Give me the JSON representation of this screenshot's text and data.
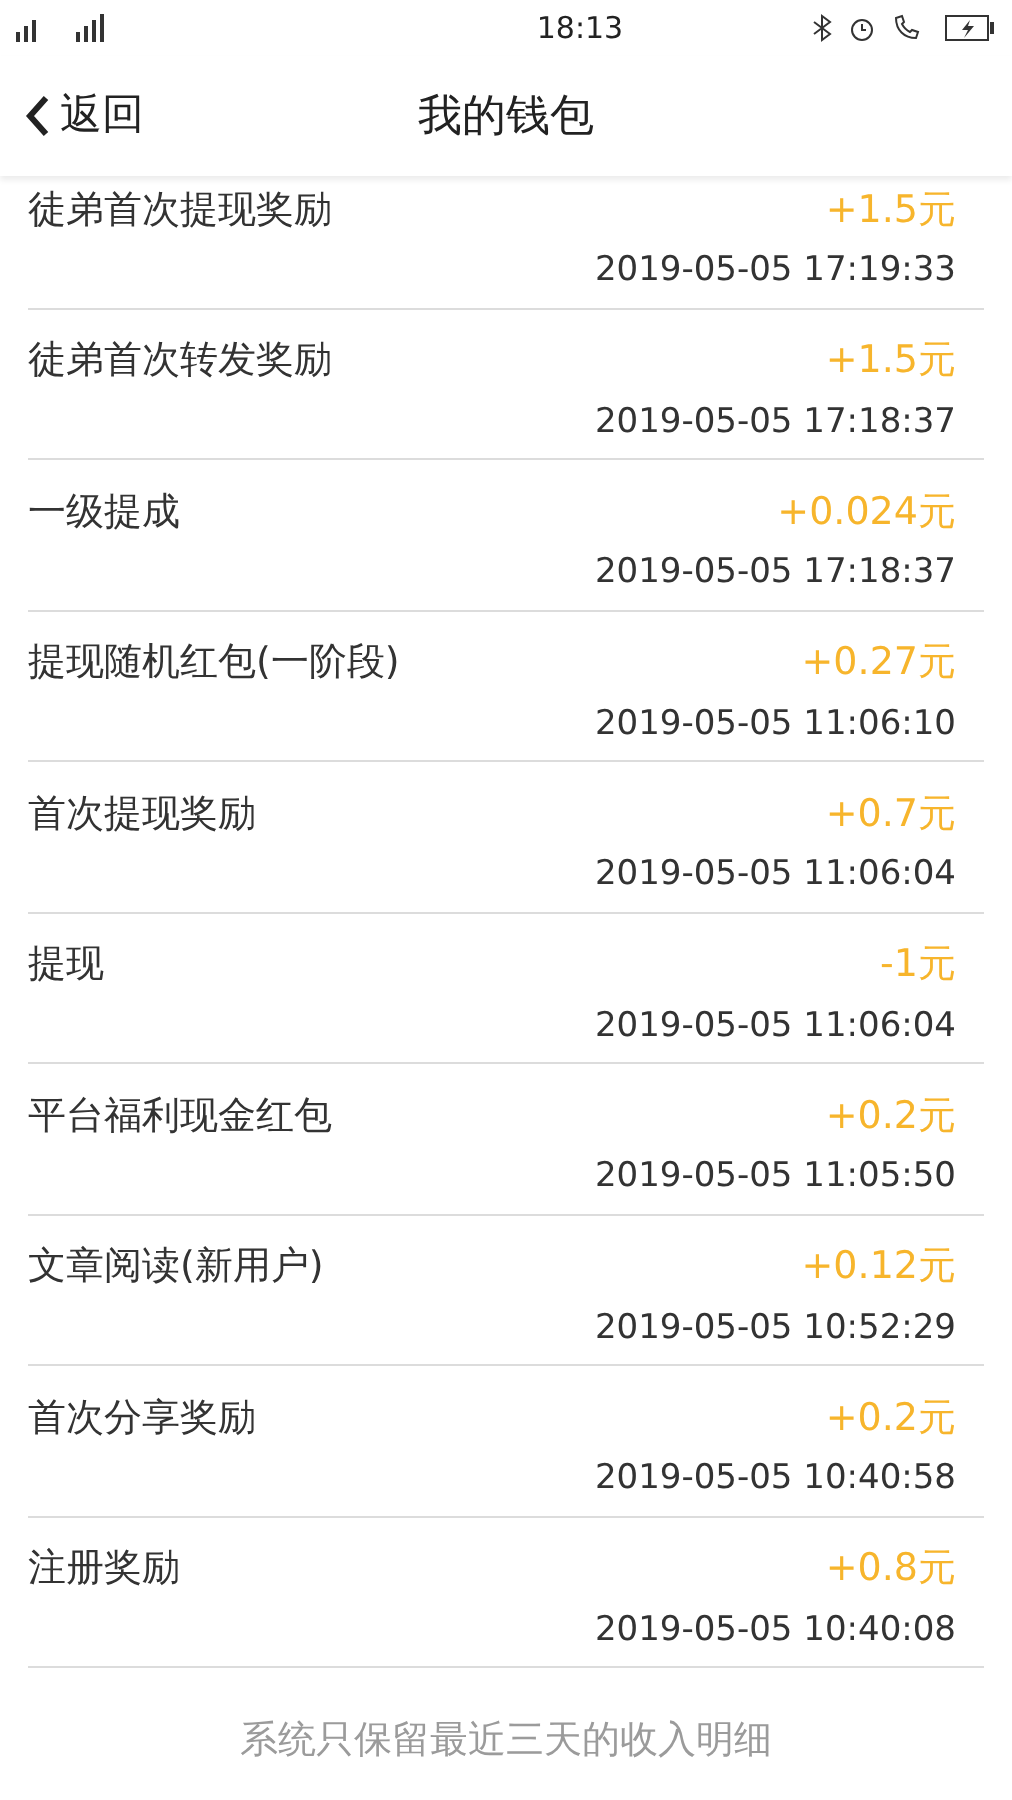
{
  "status_bar": {
    "time": "18:13"
  },
  "header": {
    "back": "返回",
    "title": "我的钱包"
  },
  "records": [
    {
      "title": "徒弟首次提现奖励",
      "amount": "+1.5元",
      "time": "2019-05-05 17:19:33"
    },
    {
      "title": "徒弟首次转发奖励",
      "amount": "+1.5元",
      "time": "2019-05-05 17:18:37"
    },
    {
      "title": "一级提成",
      "amount": "+0.024元",
      "time": "2019-05-05 17:18:37"
    },
    {
      "title": "提现随机红包(一阶段)",
      "amount": "+0.27元",
      "time": "2019-05-05 11:06:10"
    },
    {
      "title": "首次提现奖励",
      "amount": "+0.7元",
      "time": "2019-05-05 11:06:04"
    },
    {
      "title": "提现",
      "amount": "-1元",
      "time": "2019-05-05 11:06:04"
    },
    {
      "title": "平台福利现金红包",
      "amount": "+0.2元",
      "time": "2019-05-05 11:05:50"
    },
    {
      "title": "文章阅读(新用户)",
      "amount": "+0.12元",
      "time": "2019-05-05 10:52:29"
    },
    {
      "title": "首次分享奖励",
      "amount": "+0.2元",
      "time": "2019-05-05 10:40:58"
    },
    {
      "title": "注册奖励",
      "amount": "+0.8元",
      "time": "2019-05-05 10:40:08"
    }
  ],
  "footer_note": "系统只保留最近三天的收入明细"
}
